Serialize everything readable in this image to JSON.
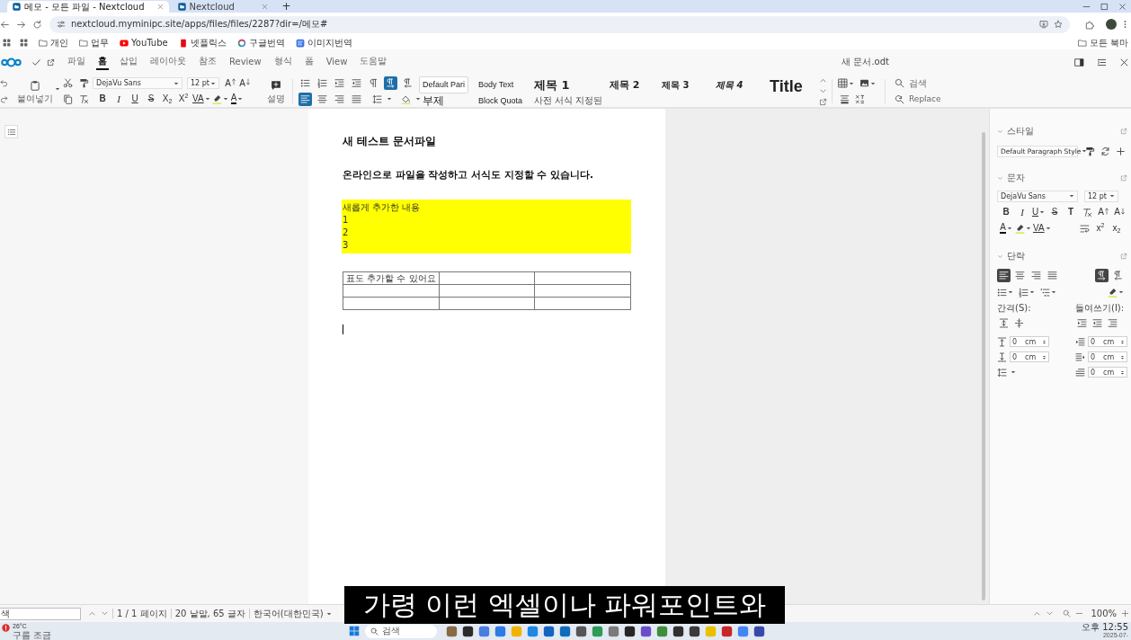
{
  "browser": {
    "tabs": [
      {
        "title": "메모 - 모든 파일 - Nextcloud",
        "selected": true
      },
      {
        "title": "Nextcloud",
        "selected": false
      }
    ],
    "new_tab": "+",
    "address": "nextcloud.myminipc.site/apps/files/files/2287?dir=/메모#",
    "bookmarks": [
      {
        "kind": "folder",
        "label": "개인"
      },
      {
        "kind": "folder",
        "label": "업무"
      },
      {
        "kind": "video",
        "label": "YouTube"
      },
      {
        "kind": "streaming",
        "label": "넷플릭스"
      },
      {
        "kind": "translator",
        "label": "구글번역"
      },
      {
        "kind": "image_translator",
        "label": "이미지번역"
      }
    ],
    "all_bookmarks": "모든 북마"
  },
  "app": {
    "menu": [
      {
        "label": "파일",
        "selected": false
      },
      {
        "label": "홈",
        "selected": true
      },
      {
        "label": "삽입",
        "selected": false
      },
      {
        "label": "레이아웃",
        "selected": false
      },
      {
        "label": "참조",
        "selected": false
      },
      {
        "label": "Review",
        "selected": false
      },
      {
        "label": "형식",
        "selected": false
      },
      {
        "label": "폼",
        "selected": false
      },
      {
        "label": "View",
        "selected": false
      },
      {
        "label": "도움말",
        "selected": false
      }
    ],
    "document_title": "새 문서.odt"
  },
  "toolbar": {
    "paste": "붙여넣기",
    "font": "DejaVu Sans",
    "size": "12 pt",
    "size_buttons": [
      {
        "kind": "grow",
        "glyph": "A",
        "menu": false
      },
      {
        "kind": "shrink",
        "glyph": "A",
        "menu": false
      }
    ],
    "format": [
      {
        "kind": "bold",
        "glyph": "B",
        "menu": false
      },
      {
        "kind": "italic",
        "glyph": "I",
        "menu": false
      },
      {
        "kind": "underline",
        "glyph": "U",
        "menu": false
      },
      {
        "kind": "strike",
        "glyph": "S",
        "menu": false
      },
      {
        "kind": "sub",
        "glyph": "X$_{2}$",
        "menu": false
      },
      {
        "kind": "sup",
        "glyph": "X$^{2}$",
        "menu": false
      },
      {
        "kind": "spacing",
        "glyph": "VA",
        "menu": true
      },
      {
        "kind": "highlight",
        "menu": true
      },
      {
        "kind": "color",
        "glyph": "A",
        "menu": true
      }
    ],
    "comment": "설명",
    "paragraph_buttons": [
      {
        "kind": "marks",
        "selected": false
      },
      {
        "kind": "ltr",
        "selected": true
      },
      {
        "kind": "rtl",
        "selected": false
      }
    ],
    "align_buttons": [
      {
        "kind": "left",
        "selected": true
      },
      {
        "kind": "center",
        "selected": false
      },
      {
        "kind": "right",
        "selected": false
      },
      {
        "kind": "justify",
        "selected": false
      }
    ],
    "style_columns": [
      {
        "items": [
          {
            "kind": "default",
            "label": "Default Pari",
            "selected": true
          },
          {
            "kind": "subtitle",
            "label": "부제",
            "selected": false
          }
        ]
      },
      {
        "items": [
          {
            "kind": "body",
            "label": "Body Text",
            "selected": false
          },
          {
            "kind": "body",
            "label": "Block Quota",
            "selected": false
          }
        ]
      },
      {
        "items": [
          {
            "kind": "heading1",
            "label": "제목 1",
            "selected": false
          },
          {
            "kind": "caption",
            "label": "사전 서식 지정된",
            "selected": false
          }
        ]
      },
      {
        "items": [
          {
            "kind": "heading2",
            "label": "제목 2",
            "selected": false
          }
        ]
      },
      {
        "items": [
          {
            "kind": "heading3",
            "label": "제목 3",
            "selected": false
          }
        ]
      },
      {
        "items": [
          {
            "kind": "heading4",
            "label": "제목 4",
            "selected": false
          }
        ]
      },
      {
        "items": [
          {
            "kind": "title",
            "label": "Title",
            "selected": false
          }
        ]
      }
    ],
    "search": "검색",
    "replace": "Replace"
  },
  "document": {
    "paragraphs": [
      {
        "kind": "heading",
        "text": "새 테스트 문서파일"
      },
      {
        "kind": "subheading",
        "text": "온라인으로 파일을 작성하고 서식도 지정할 수 있습니다."
      }
    ],
    "highlight": {
      "highlighted": true,
      "lines": [
        "새롭게 추가한 내용",
        "1",
        "2",
        "3"
      ]
    },
    "table": {
      "rows": [
        {
          "cells": [
            {
              "kind": "text",
              "text": "표도 추가할 수 있어요"
            },
            {
              "kind": "empty"
            },
            {
              "kind": "empty"
            }
          ]
        },
        {
          "cells": [
            {
              "kind": "empty"
            },
            {
              "kind": "empty"
            },
            {
              "kind": "empty"
            }
          ]
        },
        {
          "cells": [
            {
              "kind": "empty"
            },
            {
              "kind": "empty"
            },
            {
              "kind": "empty"
            }
          ]
        }
      ]
    }
  },
  "sidebar": {
    "sections": [
      {
        "kind": "style",
        "title": "스타일",
        "expanded": true,
        "style": "Default Paragraph Style"
      },
      {
        "kind": "character",
        "title": "문자",
        "expanded": true,
        "font": "DejaVu Sans",
        "size": "12 pt",
        "rows": [
          {
            "items": [
              {
                "kind": "bold",
                "glyph": "B",
                "menu": false
              },
              {
                "kind": "italic",
                "glyph": "I",
                "menu": false
              },
              {
                "kind": "underline",
                "glyph": "U",
                "menu": true
              },
              {
                "kind": "strike",
                "glyph": "S",
                "menu": false
              },
              {
                "kind": "shadow",
                "glyph": "T",
                "menu": false
              },
              {
                "kind": "clear",
                "menu": false
              },
              {
                "kind": "grow",
                "glyph": "A",
                "menu": false
              },
              {
                "kind": "shrink",
                "glyph": "A",
                "menu": false
              }
            ]
          },
          {
            "items": [
              {
                "kind": "color",
                "glyph": "A",
                "menu": true
              },
              {
                "kind": "highlight",
                "menu": true
              },
              {
                "kind": "spacing",
                "glyph": "VA",
                "menu": true
              }
            ],
            "right_items": [
              {
                "kind": "wrap",
                "menu": false
              },
              {
                "kind": "sup",
                "glyph": "x$^{2}$",
                "menu": false
              },
              {
                "kind": "sub",
                "glyph": "x$_{2}$",
                "menu": false
              }
            ]
          }
        ]
      },
      {
        "kind": "paragraph",
        "title": "단락",
        "expanded": true,
        "align_buttons": [
          {
            "kind": "left",
            "selected": true
          },
          {
            "kind": "center",
            "selected": false
          },
          {
            "kind": "right",
            "selected": false
          },
          {
            "kind": "justify",
            "selected": false
          }
        ],
        "direction_buttons": [
          {
            "kind": "ltr",
            "selected": true
          },
          {
            "kind": "rtl",
            "selected": false
          }
        ],
        "spacing_label": "간격(S):",
        "indent_label": "들여쓰기(I):",
        "spacing_fields": [
          {
            "value": "0",
            "unit": "cm"
          },
          {
            "value": "0",
            "unit": "cm"
          }
        ],
        "indent_fields": [
          {
            "value": "0",
            "unit": "cm"
          },
          {
            "value": "0",
            "unit": "cm"
          },
          {
            "value": "0",
            "unit": "cm"
          }
        ]
      }
    ]
  },
  "status_bar": {
    "find_placeholder": "색",
    "page": "1 / 1 페이지",
    "counts": "20 낱말, 65 글자",
    "language": "한국어(대한민국)",
    "zoom": "100%"
  },
  "taskbar": {
    "temperature": "26°C",
    "weather": "구름 조금",
    "search": "검색",
    "time": "오후 12:55",
    "date": "2025-07-"
  },
  "subtitle": "가령 이런 엑셀이나 파워포인트와"
}
